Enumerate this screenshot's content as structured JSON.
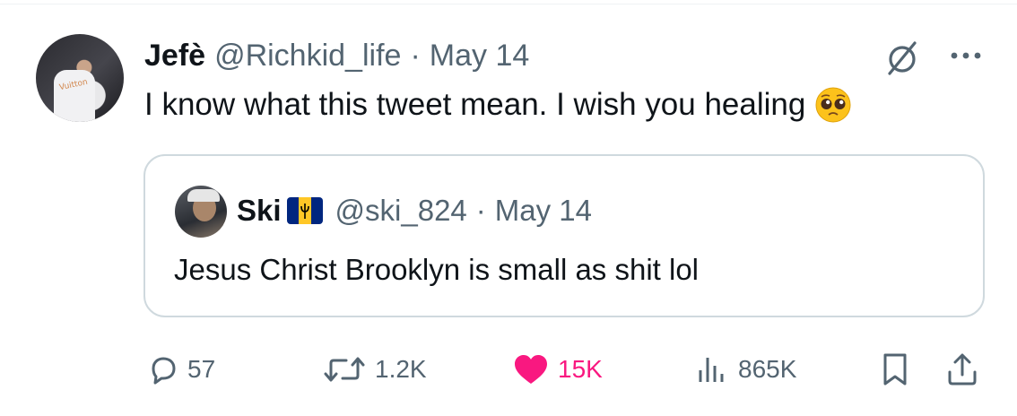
{
  "tweet": {
    "author_name": "Jefè",
    "handle": "@Richkid_life",
    "separator": "·",
    "date": "May 14",
    "text": "I know what this tweet mean. I wish you healing",
    "emoji": "pleading-face-emoji",
    "avatar_logo": "Vuitton"
  },
  "quoted": {
    "author_name": "Ski",
    "flag": "barbados-flag",
    "handle": "@ski_824",
    "separator": "·",
    "date": "May 14",
    "text": "Jesus Christ Brooklyn is small as shit lol"
  },
  "actions": {
    "replies": "57",
    "retweets": "1.2K",
    "likes": "15K",
    "views": "865K"
  },
  "colors": {
    "text": "#0f1419",
    "muted": "#536471",
    "like": "#f91880",
    "border": "#cfd9de"
  }
}
